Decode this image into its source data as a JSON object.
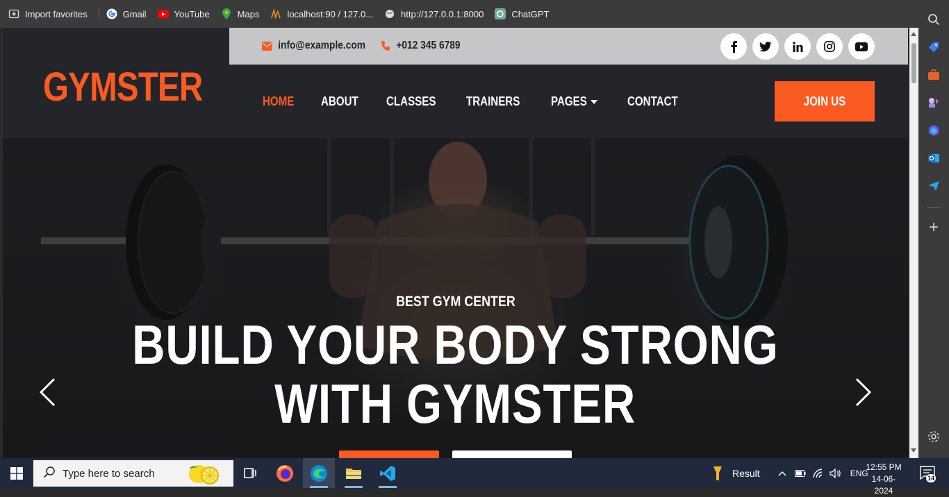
{
  "bookmarks": [
    {
      "label": "Import favorites",
      "icon": "import-icon"
    },
    {
      "label": "Gmail",
      "icon": "google-icon"
    },
    {
      "label": "YouTube",
      "icon": "youtube-icon"
    },
    {
      "label": "Maps",
      "icon": "maps-pin-icon"
    },
    {
      "label": "localhost:90 / 127.0...",
      "icon": "phpmyadmin-icon"
    },
    {
      "label": "http://127.0.0.1:8000",
      "icon": "globe-icon"
    },
    {
      "label": "ChatGPT",
      "icon": "chatgpt-icon"
    }
  ],
  "site": {
    "logo": "GYMSTER",
    "email": "info@example.com",
    "phone": "+012 345 6789",
    "social": [
      "facebook-icon",
      "twitter-icon",
      "linkedin-icon",
      "instagram-icon",
      "youtube-icon"
    ],
    "nav": [
      "HOME",
      "ABOUT",
      "CLASSES",
      "TRAINERS",
      "PAGES",
      "CONTACT"
    ],
    "join_label": "JOIN US",
    "accent": "#fb5b21",
    "header_bg": "#23252b",
    "topbar_bg": "#c6c6c8"
  },
  "hero": {
    "subtitle": "BEST GYM CENTER",
    "title_line1": "BUILD YOUR BODY STRONG",
    "title_line2": "WITH GYMSTER"
  },
  "taskbar": {
    "search_placeholder": "Type here to search",
    "tray_app_label": "Result",
    "language": "ENG",
    "time": "12:55 PM",
    "date": "14-06-2024",
    "notification_count": "14"
  }
}
